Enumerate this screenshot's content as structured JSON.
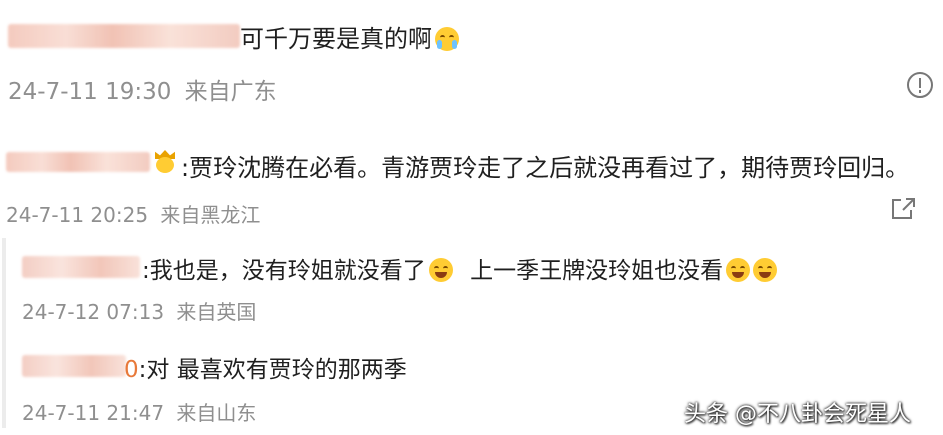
{
  "comments": [
    {
      "text": "可千万要是真的啊",
      "emoji": "crying-face",
      "timestamp": "24-7-11 19:30",
      "location": "来自广东"
    },
    {
      "badge": "crown-face",
      "text": ":贾玲沈腾在必看。青游贾玲走了之后就没再看过了，期待贾玲回归。",
      "timestamp": "24-7-11 20:25",
      "location": "来自黑龙江",
      "replies": [
        {
          "text_a": ":我也是，没有玲姐就没看了",
          "text_b": "上一季王牌没玲姐也没看",
          "emoji": "laughing-face",
          "timestamp": "24-7-12 07:13",
          "location": "来自英国"
        },
        {
          "name_suffix": "0",
          "text": ":对  最喜欢有贾玲的那两季",
          "timestamp": "24-7-11 21:47",
          "location": "来自山东"
        }
      ]
    }
  ],
  "watermark": "头条 @不八卦会死星人",
  "colors": {
    "text": "#1f1f1f",
    "meta": "#8f8f8f",
    "emoji": "#ffcc33",
    "name_suffix": "#e8793a"
  }
}
